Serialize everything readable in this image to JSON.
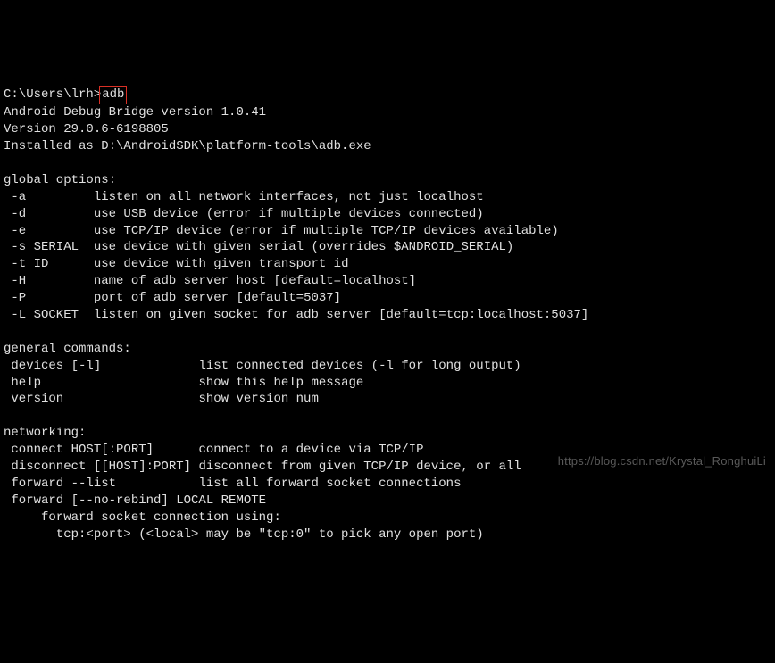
{
  "prompt": {
    "path": "C:\\Users\\lrh>",
    "command": "adb"
  },
  "version_lines": [
    "Android Debug Bridge version 1.0.41",
    "Version 29.0.6-6198805",
    "Installed as D:\\AndroidSDK\\platform-tools\\adb.exe"
  ],
  "global_options": {
    "header": "global options:",
    "items": [
      {
        "flag": " -a         ",
        "desc": "listen on all network interfaces, not just localhost"
      },
      {
        "flag": " -d         ",
        "desc": "use USB device (error if multiple devices connected)"
      },
      {
        "flag": " -e         ",
        "desc": "use TCP/IP device (error if multiple TCP/IP devices available)"
      },
      {
        "flag": " -s SERIAL  ",
        "desc": "use device with given serial (overrides $ANDROID_SERIAL)"
      },
      {
        "flag": " -t ID      ",
        "desc": "use device with given transport id"
      },
      {
        "flag": " -H         ",
        "desc": "name of adb server host [default=localhost]"
      },
      {
        "flag": " -P         ",
        "desc": "port of adb server [default=5037]"
      },
      {
        "flag": " -L SOCKET  ",
        "desc": "listen on given socket for adb server [default=tcp:localhost:5037]"
      }
    ]
  },
  "general_commands": {
    "header": "general commands:",
    "items": [
      {
        "cmd": " devices [-l]             ",
        "desc": "list connected devices (-l for long output)"
      },
      {
        "cmd": " help                     ",
        "desc": "show this help message"
      },
      {
        "cmd": " version                  ",
        "desc": "show version num"
      }
    ]
  },
  "networking": {
    "header": "networking:",
    "items": [
      {
        "cmd": " connect HOST[:PORT]      ",
        "desc": "connect to a device via TCP/IP"
      },
      {
        "cmd": " disconnect [[HOST]:PORT] ",
        "desc": "disconnect from given TCP/IP device, or all"
      },
      {
        "cmd": " forward --list           ",
        "desc": "list all forward socket connections"
      },
      {
        "cmd": " forward [--no-rebind] LOCAL REMOTE",
        "desc": ""
      }
    ],
    "extra_lines": [
      "     forward socket connection using:",
      "       tcp:<port> (<local> may be \"tcp:0\" to pick any open port)"
    ]
  },
  "watermark": "https://blog.csdn.net/Krystal_RonghuiLi"
}
